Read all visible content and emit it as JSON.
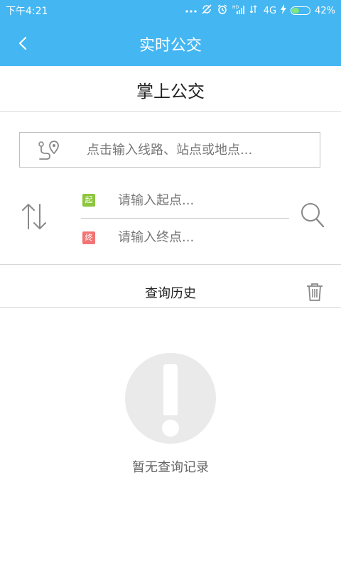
{
  "status_bar": {
    "time": "下午4:21",
    "network": "4G",
    "battery": "42%",
    "battery_level": 0.42,
    "icons": [
      "more-dots-icon",
      "sync-off-icon",
      "alarm-icon",
      "hd-signal-icon",
      "signal-icon",
      "charging-icon",
      "battery-icon"
    ]
  },
  "title_bar": {
    "title": "实时公交",
    "back_icon": "chevron-left-icon"
  },
  "sub_header": {
    "title": "掌上公交"
  },
  "search": {
    "placeholder": "点击输入线路、站点或地点...",
    "icon": "route-pin-icon"
  },
  "route_planner": {
    "start_tag": "起",
    "start_placeholder": "请输入起点...",
    "end_tag": "终",
    "end_placeholder": "请输入终点...",
    "swap_icon": "swap-arrows-icon",
    "search_icon": "search-icon"
  },
  "history": {
    "title": "查询历史",
    "clear_icon": "trash-icon"
  },
  "empty_state": {
    "icon": "exclamation-icon",
    "text": "暂无查询记录"
  },
  "colors": {
    "primary": "#44b6f2",
    "start_tag": "#8cc63f",
    "end_tag": "#f27474",
    "empty_icon": "#eaeaea"
  }
}
